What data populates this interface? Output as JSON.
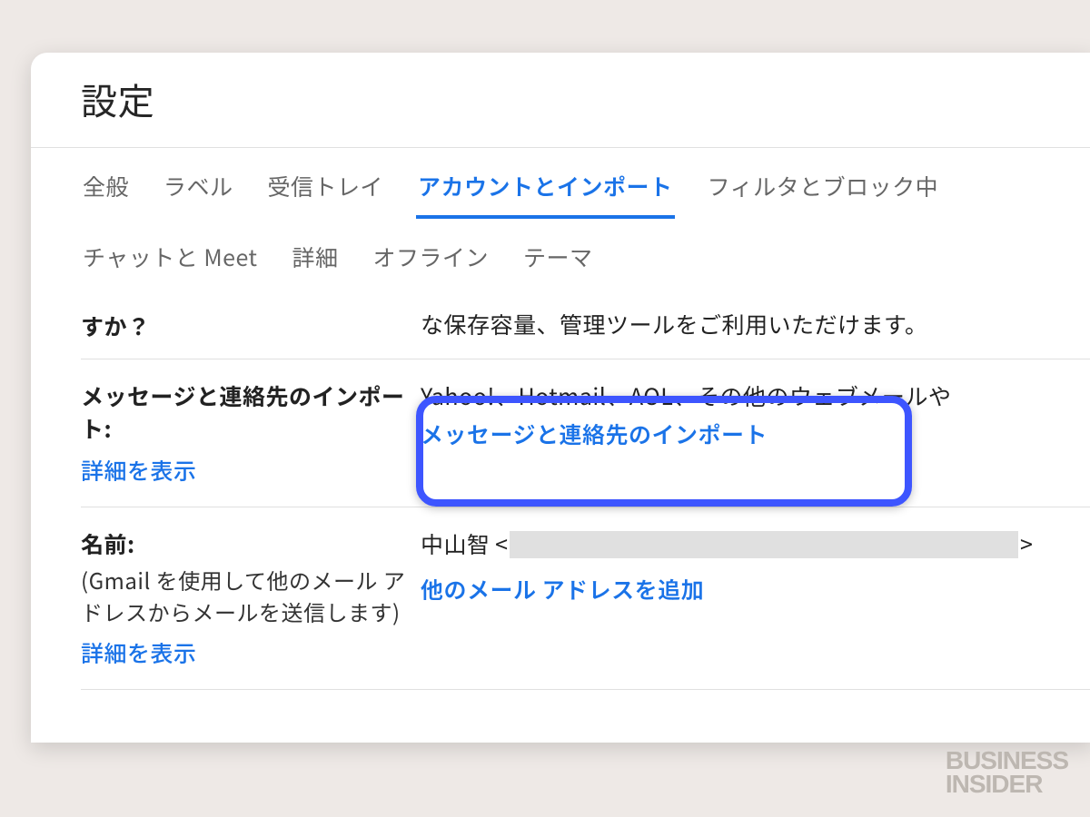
{
  "header": {
    "title": "設定"
  },
  "tabs": [
    {
      "id": "general",
      "label": "全般",
      "active": false
    },
    {
      "id": "labels",
      "label": "ラベル",
      "active": false
    },
    {
      "id": "inbox",
      "label": "受信トレイ",
      "active": false
    },
    {
      "id": "accounts",
      "label": "アカウントとインポート",
      "active": true
    },
    {
      "id": "filters",
      "label": "フィルタとブロック中",
      "active": false
    },
    {
      "id": "chatmeet",
      "label": "チャットと Meet",
      "active": false
    },
    {
      "id": "advanced",
      "label": "詳細",
      "active": false
    },
    {
      "id": "offline",
      "label": "オフライン",
      "active": false
    },
    {
      "id": "themes",
      "label": "テーマ",
      "active": false
    }
  ],
  "sections": {
    "business": {
      "label_tail": "すか？",
      "desc_tail": "な保存容量、管理ツールをご利用いただけます。"
    },
    "import": {
      "label": "メッセージと連絡先のインポート:",
      "learn_more": "詳細を表示",
      "desc": "Yahoo!、Hotmail、AOL、その他のウェブメールや",
      "action_link": "メッセージと連絡先のインポート"
    },
    "send_as": {
      "label": "名前:",
      "sublabel": "(Gmail を使用して他のメール アドレスからメールを送信します)",
      "learn_more": "詳細を表示",
      "name": "中山智",
      "email": "[redacted]",
      "add_link": "他のメール アドレスを追加"
    }
  },
  "watermark": {
    "line1": "BUSINESS",
    "line2": "INSIDER"
  },
  "colors": {
    "accent": "#1a73e8",
    "highlight_border": "#3d55ff"
  }
}
